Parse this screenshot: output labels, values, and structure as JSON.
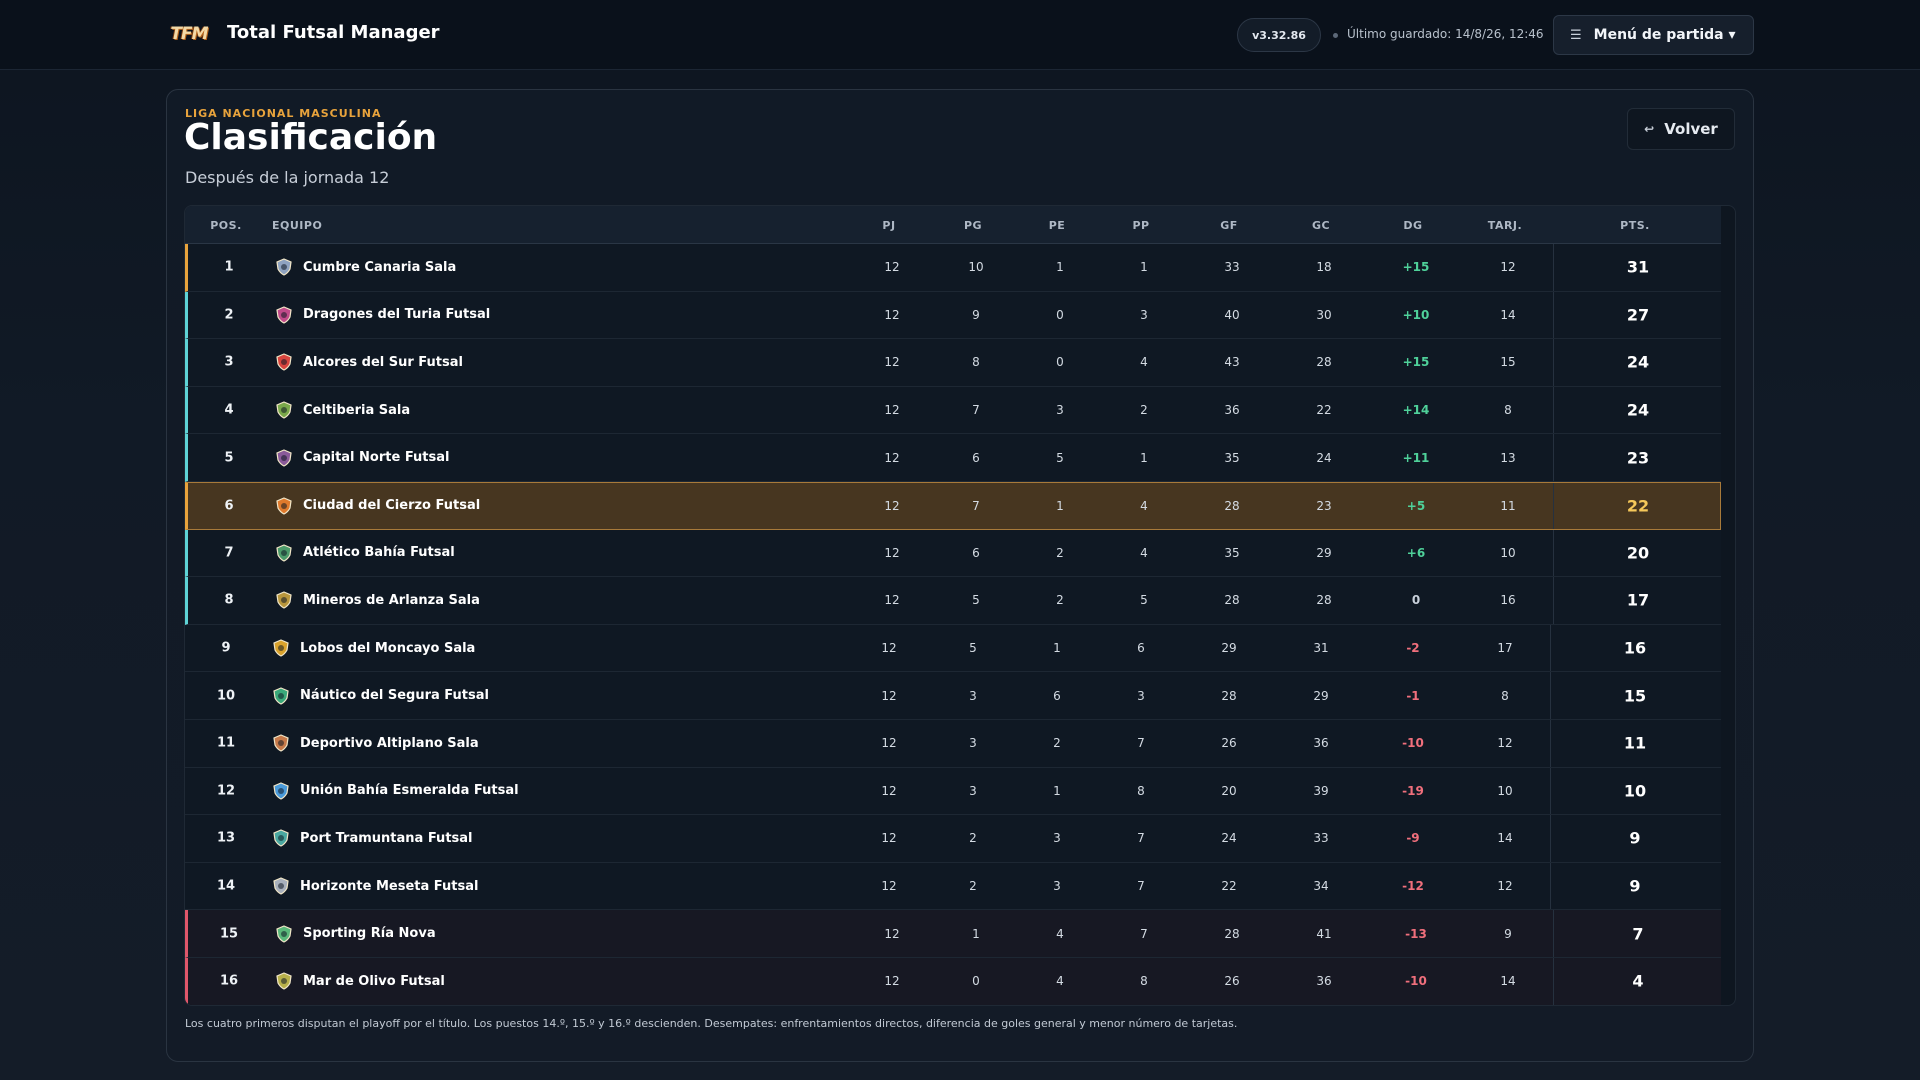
{
  "app": {
    "logo_text": "TFM",
    "title": "Total Futsal Manager",
    "version": "v3.32.86",
    "last_saved": "Último guardado: 14/8/26, 12:46",
    "menu_label": "Menú de partida ▾",
    "menu_icon": "☰"
  },
  "page": {
    "league": "LIGA NACIONAL MASCULINA",
    "title": "Clasificación",
    "subtitle": "Después de la jornada 12",
    "back_label": "Volver",
    "back_icon": "↩"
  },
  "colors": {
    "accent": "#e8a33c",
    "playoff": "#5ed3d6",
    "relegation": "#e0576b",
    "positive": "#4fd19a",
    "negative": "#f06f7c",
    "highlight_row": "#473620"
  },
  "table": {
    "headers": {
      "pos": "POS.",
      "team": "EQUIPO",
      "pj": "PJ",
      "pg": "PG",
      "pe": "PE",
      "pp": "PP",
      "gf": "GF",
      "gc": "GC",
      "dg": "DG",
      "tarj": "TARJ.",
      "pts": "PTS."
    },
    "rows": [
      {
        "pos": "1",
        "team": "Cumbre Canaria Sala",
        "pj": "12",
        "pg": "10",
        "pe": "1",
        "pp": "1",
        "gf": "33",
        "gc": "18",
        "dg": "+15",
        "tarj": "12",
        "pts": "31",
        "zone": "first",
        "crest_color": "#8fa3c0"
      },
      {
        "pos": "2",
        "team": "Dragones del Turia Futsal",
        "pj": "12",
        "pg": "9",
        "pe": "0",
        "pp": "3",
        "gf": "40",
        "gc": "30",
        "dg": "+10",
        "tarj": "14",
        "pts": "27",
        "zone": "playoff",
        "crest_color": "#c14a8a"
      },
      {
        "pos": "3",
        "team": "Alcores del Sur Futsal",
        "pj": "12",
        "pg": "8",
        "pe": "0",
        "pp": "4",
        "gf": "43",
        "gc": "28",
        "dg": "+15",
        "tarj": "15",
        "pts": "24",
        "zone": "playoff",
        "crest_color": "#d9453e"
      },
      {
        "pos": "4",
        "team": "Celtiberia Sala",
        "pj": "12",
        "pg": "7",
        "pe": "3",
        "pp": "2",
        "gf": "36",
        "gc": "22",
        "dg": "+14",
        "tarj": "8",
        "pts": "24",
        "zone": "playoff",
        "crest_color": "#7aa84a"
      },
      {
        "pos": "5",
        "team": "Capital Norte Futsal",
        "pj": "12",
        "pg": "6",
        "pe": "5",
        "pp": "1",
        "gf": "35",
        "gc": "24",
        "dg": "+11",
        "tarj": "13",
        "pts": "23",
        "zone": "playoff",
        "crest_color": "#8a5a9a"
      },
      {
        "pos": "6",
        "team": "Ciudad del Cierzo Futsal",
        "pj": "12",
        "pg": "7",
        "pe": "1",
        "pp": "4",
        "gf": "28",
        "gc": "23",
        "dg": "+5",
        "tarj": "11",
        "pts": "22",
        "zone": "highlight",
        "crest_color": "#e07a2c"
      },
      {
        "pos": "7",
        "team": "Atlético Bahía Futsal",
        "pj": "12",
        "pg": "6",
        "pe": "2",
        "pp": "4",
        "gf": "35",
        "gc": "29",
        "dg": "+6",
        "tarj": "10",
        "pts": "20",
        "zone": "playoff",
        "crest_color": "#4c9a6a"
      },
      {
        "pos": "8",
        "team": "Mineros de Arlanza Sala",
        "pj": "12",
        "pg": "5",
        "pe": "2",
        "pp": "5",
        "gf": "28",
        "gc": "28",
        "dg": "0",
        "tarj": "16",
        "pts": "17",
        "zone": "playoff",
        "crest_color": "#b8963c"
      },
      {
        "pos": "9",
        "team": "Lobos del Moncayo Sala",
        "pj": "12",
        "pg": "5",
        "pe": "1",
        "pp": "6",
        "gf": "29",
        "gc": "31",
        "dg": "-2",
        "tarj": "17",
        "pts": "16",
        "zone": "none",
        "crest_color": "#d9a22c"
      },
      {
        "pos": "10",
        "team": "Náutico del Segura Futsal",
        "pj": "12",
        "pg": "3",
        "pe": "6",
        "pp": "3",
        "gf": "28",
        "gc": "29",
        "dg": "-1",
        "tarj": "8",
        "pts": "15",
        "zone": "none",
        "crest_color": "#3aa97a"
      },
      {
        "pos": "11",
        "team": "Deportivo Altiplano Sala",
        "pj": "12",
        "pg": "3",
        "pe": "2",
        "pp": "7",
        "gf": "26",
        "gc": "36",
        "dg": "-10",
        "tarj": "12",
        "pts": "11",
        "zone": "none",
        "crest_color": "#c77a4a"
      },
      {
        "pos": "12",
        "team": "Unión Bahía Esmeralda Futsal",
        "pj": "12",
        "pg": "3",
        "pe": "1",
        "pp": "8",
        "gf": "20",
        "gc": "39",
        "dg": "-19",
        "tarj": "10",
        "pts": "10",
        "zone": "none",
        "crest_color": "#4a9ad9"
      },
      {
        "pos": "13",
        "team": "Port Tramuntana Futsal",
        "pj": "12",
        "pg": "2",
        "pe": "3",
        "pp": "7",
        "gf": "24",
        "gc": "33",
        "dg": "-9",
        "tarj": "14",
        "pts": "9",
        "zone": "none",
        "crest_color": "#4aa8a0"
      },
      {
        "pos": "14",
        "team": "Horizonte Meseta Futsal",
        "pj": "12",
        "pg": "2",
        "pe": "3",
        "pp": "7",
        "gf": "22",
        "gc": "34",
        "dg": "-12",
        "tarj": "12",
        "pts": "9",
        "zone": "none",
        "crest_color": "#a8b0bc"
      },
      {
        "pos": "15",
        "team": "Sporting Ría Nova",
        "pj": "12",
        "pg": "1",
        "pe": "4",
        "pp": "7",
        "gf": "28",
        "gc": "41",
        "dg": "-13",
        "tarj": "9",
        "pts": "7",
        "zone": "relegation",
        "crest_color": "#5ab87a"
      },
      {
        "pos": "16",
        "team": "Mar de Olivo Futsal",
        "pj": "12",
        "pg": "0",
        "pe": "4",
        "pp": "8",
        "gf": "26",
        "gc": "36",
        "dg": "-10",
        "tarj": "14",
        "pts": "4",
        "zone": "relegation",
        "crest_color": "#b8b04a"
      }
    ]
  },
  "footnote": "Los cuatro primeros disputan el playoff por el título. Los puestos 14.º, 15.º y 16.º descienden. Desempates: enfrentamientos directos, diferencia de goles general y menor número de tarjetas."
}
